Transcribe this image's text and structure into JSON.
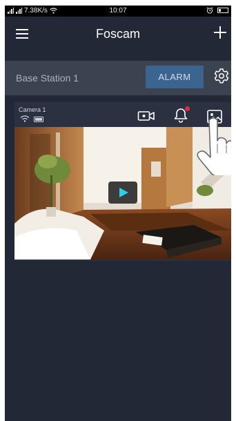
{
  "status_bar": {
    "network_speed": "7.38K/s",
    "time": "10:07"
  },
  "header": {
    "title": "Foscam",
    "menu_icon": "hamburger-menu-icon",
    "add_icon": "plus-icon"
  },
  "base_station": {
    "name": "Base Station 1",
    "alarm_label": "ALARM",
    "settings_icon": "gear-icon"
  },
  "camera": {
    "name": "Camera 1",
    "wifi_icon": "wifi-icon",
    "battery_icon": "battery-icon",
    "record_icon": "video-camera-icon",
    "notifications_icon": "bell-icon",
    "notification_badge": true,
    "gallery_icon": "photo-gallery-icon",
    "play_icon": "play-icon"
  },
  "colors": {
    "background": "#222835",
    "base_row": "#3b4250",
    "alarm_button": "#3c6491",
    "play_triangle": "#2ed0e8",
    "badge": "#e8283a"
  }
}
